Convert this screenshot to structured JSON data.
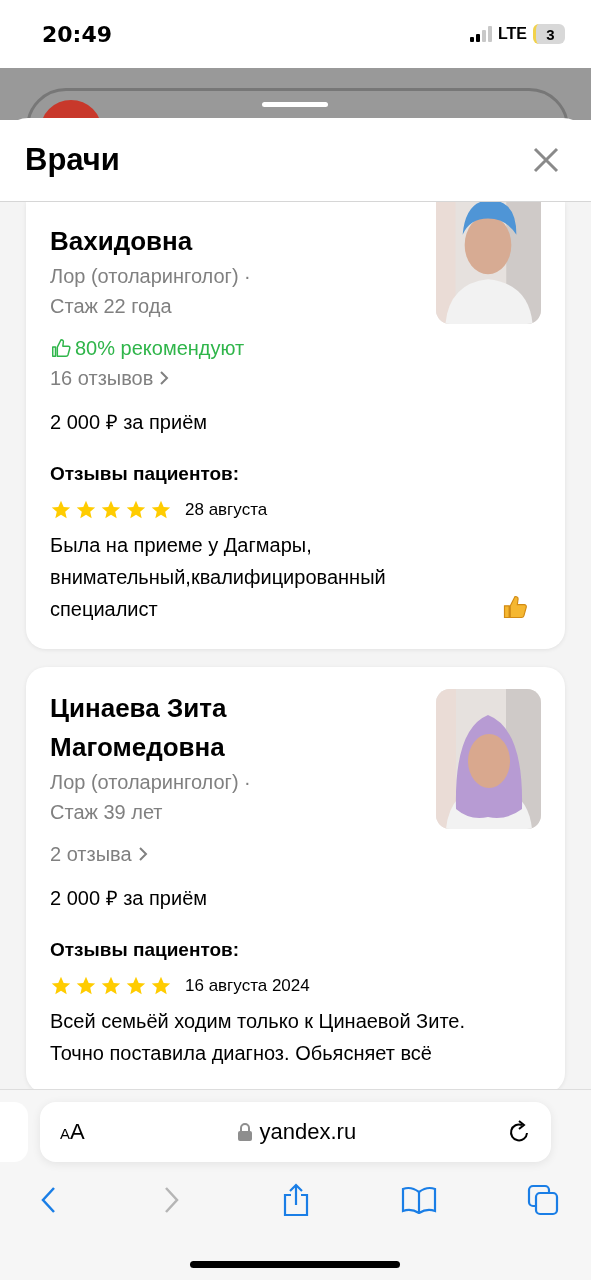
{
  "status_bar": {
    "time": "20:49",
    "network": "LTE",
    "battery": "3"
  },
  "sheet": {
    "title": "Врачи"
  },
  "doctors": [
    {
      "name": "Вахидовна",
      "continued": true,
      "specialty": "Лор (отоларинголог) ·",
      "experience": "Стаж 22 года",
      "recommend": "80% рекомендуют",
      "reviews_link": "16 отзывов",
      "price": "2 000 ₽ за приём",
      "reviews_title": "Отзывы пациентов:",
      "review": {
        "stars": 5,
        "date": "28 августа",
        "text": "Была на приеме у Дагмары, внимательный,квалифицированный специалист",
        "thumbs_up": true
      }
    },
    {
      "name": "Цинаева Зита Магомедовна",
      "continued": false,
      "specialty": "Лор (отоларинголог) ·",
      "experience": "Стаж 39 лет",
      "reviews_link": "2 отзыва",
      "price": "2 000 ₽ за приём",
      "reviews_title": "Отзывы пациентов:",
      "review": {
        "stars": 5,
        "date": "16 августа 2024",
        "text": "Всей семьёй ходим только к Цинаевой Зите. Точно поставила диагноз. Обьясняет всё",
        "thumbs_up": false
      }
    }
  ],
  "browser": {
    "text_size_button": "AA",
    "url": "yandex.ru",
    "back_enabled": true,
    "forward_enabled": false
  }
}
